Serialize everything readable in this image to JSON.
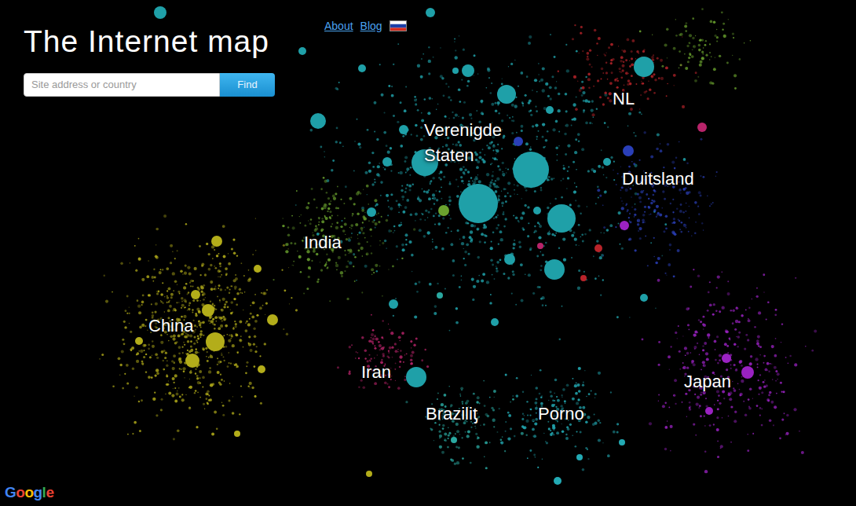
{
  "header": {
    "title": "The Internet map",
    "search": {
      "placeholder": "Site address or country"
    },
    "button": "Find",
    "links": [
      "About",
      "Blog"
    ]
  },
  "clusters": [
    {
      "label": "Verenigde Staten",
      "color": "#1fa0a8"
    },
    {
      "label": "NL",
      "color": "#b8242a"
    },
    {
      "label": "Duitsland",
      "color": "#2a3fb8"
    },
    {
      "label": "India",
      "color": "#6aa22e"
    },
    {
      "label": "China",
      "color": "#b3ad1a"
    },
    {
      "label": "Iran",
      "color": "#b8246a"
    },
    {
      "label": "Braziliƫ",
      "color": "#2aa8a0"
    },
    {
      "label": "Porno",
      "color": "#23aab4"
    },
    {
      "label": "Japan",
      "color": "#9a22c2"
    }
  ],
  "logo": "Google"
}
